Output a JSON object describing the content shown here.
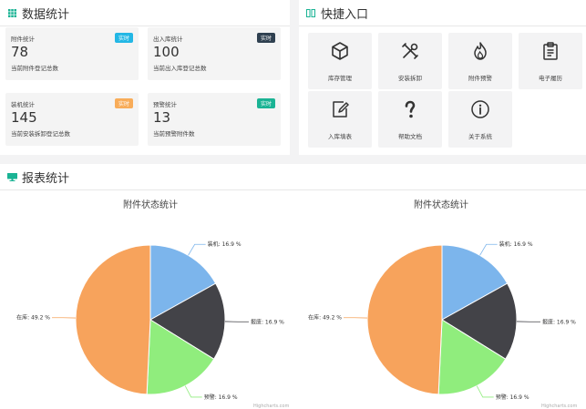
{
  "data_stats": {
    "title": "数据统计",
    "cards": [
      {
        "label": "附件统计",
        "value": "78",
        "desc": "当前附件登记总数",
        "badge": "实时",
        "badge_color": "#23b7e5"
      },
      {
        "label": "出入库统计",
        "value": "100",
        "desc": "当前出入库登记总数",
        "badge": "实时",
        "badge_color": "#2f4050"
      },
      {
        "label": "装机统计",
        "value": "145",
        "desc": "当前安装拆卸登记总数",
        "badge": "实时",
        "badge_color": "#f8ac59"
      },
      {
        "label": "预警统计",
        "value": "13",
        "desc": "当前预警附件数",
        "badge": "实时",
        "badge_color": "#1ab394"
      }
    ]
  },
  "quick_access": {
    "title": "快捷入口",
    "items": [
      {
        "label": "库存管理",
        "icon": "cube-icon"
      },
      {
        "label": "安装拆卸",
        "icon": "tools-icon"
      },
      {
        "label": "附件预警",
        "icon": "flame-icon"
      },
      {
        "label": "电子履历",
        "icon": "clipboard-icon"
      },
      {
        "label": "入库填表",
        "icon": "form-edit-icon"
      },
      {
        "label": "帮助文档",
        "icon": "question-icon"
      },
      {
        "label": "关于系统",
        "icon": "info-icon"
      }
    ]
  },
  "report_stats": {
    "title": "报表统计",
    "credit": "Highcharts.com"
  },
  "chart_data": [
    {
      "type": "pie",
      "title": "附件状态统计",
      "slices": [
        {
          "name": "装机",
          "value": 16.9,
          "label": "装机: 16.9 %",
          "color": "#7cb5ec"
        },
        {
          "name": "报废",
          "value": 16.9,
          "label": "报废: 16.9 %",
          "color": "#434348"
        },
        {
          "name": "预警",
          "value": 16.9,
          "label": "预警: 16.9 %",
          "color": "#90ed7d"
        },
        {
          "name": "在库",
          "value": 49.2,
          "label": "在库: 49.2 %",
          "color": "#f7a35c"
        }
      ]
    },
    {
      "type": "pie",
      "title": "附件状态统计",
      "slices": [
        {
          "name": "装机",
          "value": 16.9,
          "label": "装机: 16.9 %",
          "color": "#7cb5ec"
        },
        {
          "name": "报废",
          "value": 16.9,
          "label": "报废: 16.9 %",
          "color": "#434348"
        },
        {
          "name": "预警",
          "value": 16.9,
          "label": "预警: 16.9 %",
          "color": "#90ed7d"
        },
        {
          "name": "在库",
          "value": 49.2,
          "label": "在库: 49.2 %",
          "color": "#f7a35c"
        }
      ]
    }
  ]
}
